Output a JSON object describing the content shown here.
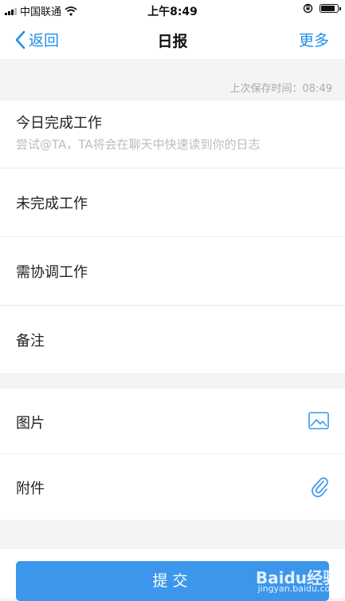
{
  "status_bar": {
    "carrier": "中国联通",
    "time": "上午8:49",
    "battery_level": 0.85
  },
  "nav": {
    "back_label": "返回",
    "title": "日报",
    "more_label": "更多"
  },
  "save_time": "上次保存时间：08:49",
  "form": {
    "today_done": {
      "label": "今日完成工作",
      "placeholder": "尝试@TA，TA将会在聊天中快速读到你的日志"
    },
    "unfinished": {
      "label": "未完成工作"
    },
    "coordinate": {
      "label": "需协调工作"
    },
    "remark": {
      "label": "备注"
    }
  },
  "attachments": {
    "image_label": "图片",
    "image_icon": "image-icon",
    "file_label": "附件",
    "file_icon": "paperclip-icon"
  },
  "submit_label": "提交",
  "watermark": {
    "brand": "Baidu经验",
    "url": "jingyan.baidu.com"
  },
  "colors": {
    "accent": "#1e90e8",
    "submit": "#3c97ec",
    "background": "#f4f4f4"
  }
}
